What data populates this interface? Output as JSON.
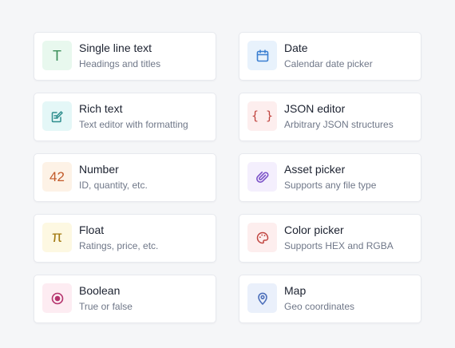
{
  "field_types": [
    {
      "title": "Single line text",
      "subtitle": "Headings and titles",
      "icon": "text-t-icon",
      "glyph": "T",
      "bg": "#e8f8ee",
      "fg": "#3b8f5a"
    },
    {
      "title": "Date",
      "subtitle": "Calendar date picker",
      "icon": "calendar-icon",
      "glyph": "",
      "bg": "#e8f2fc",
      "fg": "#3b7fd1"
    },
    {
      "title": "Rich text",
      "subtitle": "Text editor with formatting",
      "icon": "edit-document-icon",
      "glyph": "",
      "bg": "#e4f7f7",
      "fg": "#2f8e8e"
    },
    {
      "title": "JSON editor",
      "subtitle": "Arbitrary JSON structures",
      "icon": "braces-icon",
      "glyph": "{ }",
      "bg": "#fdeeee",
      "fg": "#c0443f"
    },
    {
      "title": "Number",
      "subtitle": "ID, quantity, etc.",
      "icon": "number-icon",
      "glyph": "42",
      "bg": "#fdf2e6",
      "fg": "#c25a2a"
    },
    {
      "title": "Asset picker",
      "subtitle": "Supports any file type",
      "icon": "paperclip-icon",
      "glyph": "",
      "bg": "#f4effd",
      "fg": "#7b52c8"
    },
    {
      "title": "Float",
      "subtitle": "Ratings, price, etc.",
      "icon": "pi-icon",
      "glyph": "π",
      "bg": "#fdf8e2",
      "fg": "#a37a13"
    },
    {
      "title": "Color picker",
      "subtitle": "Supports HEX and RGBA",
      "icon": "palette-icon",
      "glyph": "",
      "bg": "#fdeeee",
      "fg": "#c0443f"
    },
    {
      "title": "Boolean",
      "subtitle": "True or false",
      "icon": "radio-icon",
      "glyph": "",
      "bg": "#fdecf2",
      "fg": "#b5336d"
    },
    {
      "title": "Map",
      "subtitle": "Geo coordinates",
      "icon": "map-pin-icon",
      "glyph": "",
      "bg": "#eaf0fb",
      "fg": "#4d6fba"
    }
  ]
}
